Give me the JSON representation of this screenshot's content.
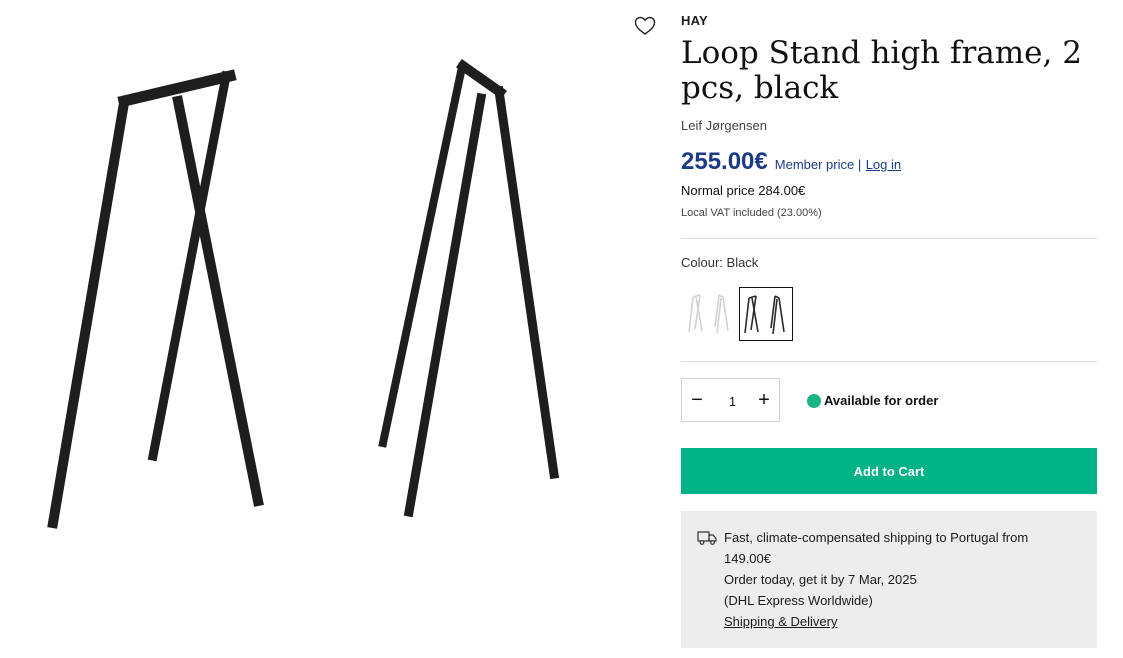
{
  "product": {
    "brand": "HAY",
    "title": "Loop Stand high frame, 2 pcs, black",
    "designer": "Leif Jørgensen",
    "wishlist_icon": "heart-icon"
  },
  "pricing": {
    "member_price": "255.00€",
    "member_label": "Member price |",
    "login_label": "Log in",
    "normal_price": "Normal price 284.00€",
    "vat_note": "Local VAT included (23.00%)"
  },
  "colour": {
    "label": "Colour: Black",
    "options": [
      "White",
      "Black"
    ],
    "selected": "Black"
  },
  "quantity": {
    "minus_label": "−",
    "value": "1",
    "plus_label": "+"
  },
  "availability": {
    "text": "Available for order",
    "status_color": "#1bb587"
  },
  "cart": {
    "button_label": "Add to Cart",
    "button_color": "#00b386"
  },
  "shipping": {
    "icon": "truck-icon",
    "line1": "Fast, climate-compensated shipping to Portugal from 149.00€",
    "line2": "Order today, get it by 7 Mar, 2025",
    "line3": "(DHL Express Worldwide)",
    "link_label": "Shipping & Delivery"
  },
  "colors": {
    "member_price": "#1b3b86",
    "shipping_bg": "#ededed"
  }
}
